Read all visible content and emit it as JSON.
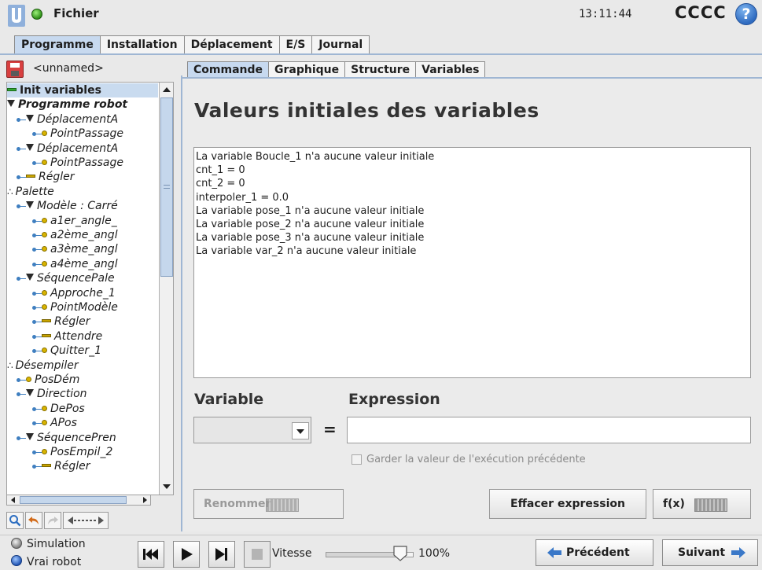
{
  "header": {
    "file_label": "Fichier",
    "clock": "13:11:44",
    "robot_name": "CCCC",
    "help_glyph": "?",
    "status_color": "#3a9e1f"
  },
  "main_tabs": [
    "Programme",
    "Installation",
    "Déplacement",
    "E/S",
    "Journal"
  ],
  "program": {
    "name": "<unnamed>"
  },
  "tree": [
    {
      "label": "Init variables",
      "icon": "bar-green",
      "depth": 0,
      "style": "bold",
      "selected": true
    },
    {
      "label": "Programme robot",
      "icon": "triangle",
      "depth": 0,
      "style": "bold-italic"
    },
    {
      "label": "DéplacementA",
      "icon": "triangle",
      "depth": 1
    },
    {
      "label": "PointPassage",
      "icon": "dot",
      "depth": 2
    },
    {
      "label": "DéplacementA",
      "icon": "triangle",
      "depth": 1
    },
    {
      "label": "PointPassage",
      "icon": "dot",
      "depth": 2
    },
    {
      "label": "Régler",
      "icon": "bar",
      "depth": 1
    },
    {
      "label": "Palette",
      "icon": "palette",
      "depth": 0
    },
    {
      "label": "Modèle : Carré",
      "icon": "triangle",
      "depth": 1
    },
    {
      "label": "a1er_angle_",
      "icon": "dot",
      "depth": 2
    },
    {
      "label": "a2ème_angl",
      "icon": "dot",
      "depth": 2
    },
    {
      "label": "a3ème_angl",
      "icon": "dot",
      "depth": 2
    },
    {
      "label": "a4ème_angl",
      "icon": "dot",
      "depth": 2
    },
    {
      "label": "SéquencePale",
      "icon": "triangle",
      "depth": 1
    },
    {
      "label": "Approche_1",
      "icon": "dot",
      "depth": 2
    },
    {
      "label": "PointModèle",
      "icon": "dot",
      "depth": 2
    },
    {
      "label": "Régler",
      "icon": "bar",
      "depth": 2
    },
    {
      "label": "Attendre",
      "icon": "bar",
      "depth": 2
    },
    {
      "label": "Quitter_1",
      "icon": "dot",
      "depth": 2
    },
    {
      "label": "Désempiler",
      "icon": "palette",
      "depth": 0
    },
    {
      "label": "PosDém",
      "icon": "dot",
      "depth": 1
    },
    {
      "label": "Direction",
      "icon": "triangle",
      "depth": 1
    },
    {
      "label": "DePos",
      "icon": "dot",
      "depth": 2
    },
    {
      "label": "APos",
      "icon": "dot",
      "depth": 2
    },
    {
      "label": "SéquencePren",
      "icon": "triangle",
      "depth": 1
    },
    {
      "label": "PosEmpil_2",
      "icon": "dot",
      "depth": 2
    },
    {
      "label": "Régler",
      "icon": "bar",
      "depth": 2
    }
  ],
  "sub_tabs": [
    "Commande",
    "Graphique",
    "Structure",
    "Variables"
  ],
  "main": {
    "title": "Valeurs initiales des variables",
    "variables": [
      "La variable Boucle_1 n'a aucune valeur initiale",
      "cnt_1 = 0",
      "cnt_2 = 0",
      "interpoler_1 = 0.0",
      "La variable pose_1 n'a aucune valeur initiale",
      "La variable pose_2 n'a aucune valeur initiale",
      "La variable pose_3 n'a aucune valeur initiale",
      "La variable var_2 n'a aucune valeur initiale"
    ],
    "variable_heading": "Variable",
    "expression_heading": "Expression",
    "equals": "=",
    "variable_value": "",
    "expression_value": "",
    "keep_value_label": "Garder la valeur de l'exécution précédente",
    "rename_label": "Renommer",
    "clear_expression_label": "Effacer expression",
    "fx_label": "f(x)"
  },
  "footer": {
    "simulation_label": "Simulation",
    "real_robot_label": "Vrai robot",
    "speed_label": "Vitesse",
    "speed_percent": 100,
    "speed_text": "100%",
    "previous_label": "Précédent",
    "next_label": "Suivant",
    "arrow_color": "#3a78c8"
  },
  "icons": {
    "logo": "ur-logo-icon",
    "help": "help-icon",
    "save": "save-icon",
    "search": "search-icon",
    "undo": "undo-icon",
    "redo": "redo-icon",
    "move": "move-arrows-icon"
  }
}
